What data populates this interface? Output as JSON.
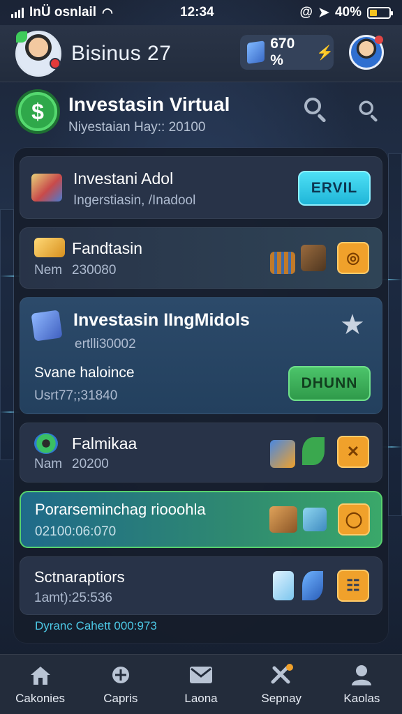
{
  "status_bar": {
    "carrier": "InÜ osnlail",
    "time": "12:34",
    "battery": "40%",
    "battery_level": 0.4
  },
  "header": {
    "title": "Bisinus 27",
    "coins": "670 %"
  },
  "page": {
    "title": "Investasin Virtual",
    "subtitle": "Niyestaian Hay:: 20100"
  },
  "cards": [
    {
      "title": "Investani Adol",
      "subtitle": "Ingerstiasin, /Inadool",
      "button": "ERVIL",
      "icons": [
        "store-icon"
      ]
    },
    {
      "title": "Fandtasin",
      "label": "Nem",
      "value": "230080",
      "icons": [
        "gold-bars-icon",
        "building-icon",
        "tools-icon",
        "coin-button-icon"
      ]
    },
    {
      "title": "Investasin IIngMidols",
      "subtitle": "ertlli30002",
      "label": "Svane haloince",
      "value": "Usrt77;;31840",
      "button": "DHUNN",
      "icons": [
        "cube-icon",
        "star-icon"
      ]
    },
    {
      "title": "Falmikaa",
      "label": "Nam",
      "value": "20200",
      "icons": [
        "gears-icon",
        "chart-icon",
        "leaf-icon",
        "cross-button-icon"
      ]
    },
    {
      "title": "Porarseminchag riooohla",
      "value": "02100:06:070",
      "icons": [
        "crate-icon",
        "box-icon",
        "camera-button-icon"
      ]
    },
    {
      "title": "Sctnaraptiors",
      "value": "1amt):25:536",
      "icons": [
        "card-icon",
        "feather-icon",
        "grid-button-icon"
      ]
    }
  ],
  "footer_note": "Dyranc Cahett 000:973",
  "nav": [
    {
      "label": "Cakonies",
      "icon": "home-icon"
    },
    {
      "label": "Capris",
      "icon": "badge-icon"
    },
    {
      "label": "Laona",
      "icon": "mail-icon"
    },
    {
      "label": "Sepnay",
      "icon": "tools-icon"
    },
    {
      "label": "Kaolas",
      "icon": "user-icon"
    }
  ],
  "colors": {
    "accent_cyan": "#2ec6e6",
    "accent_green": "#3db35a",
    "accent_orange": "#f0a12b"
  }
}
